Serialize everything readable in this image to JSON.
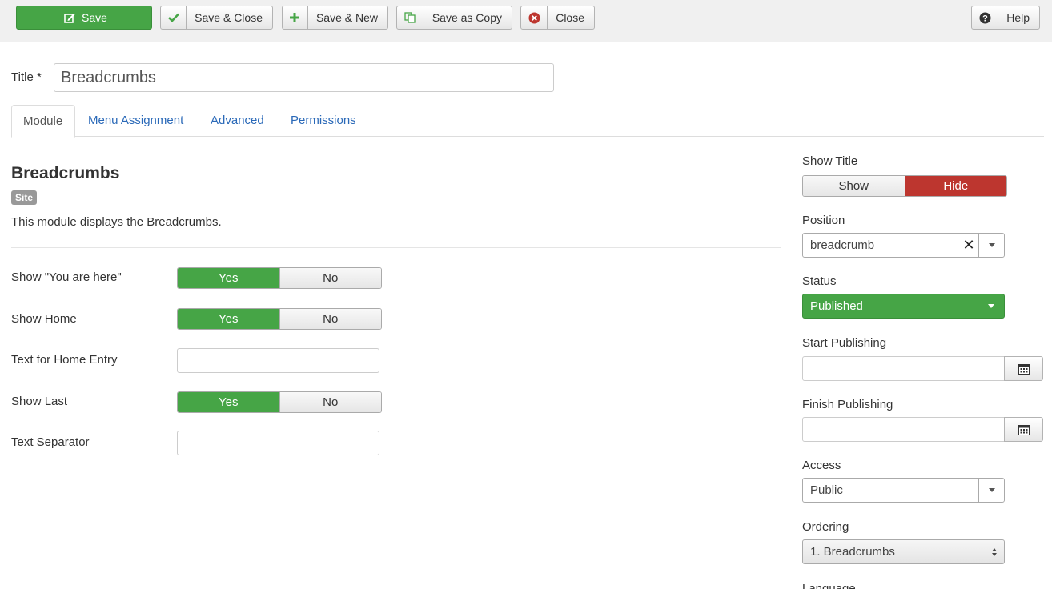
{
  "toolbar": {
    "save_label": "Save",
    "save_close_label": "Save & Close",
    "save_new_label": "Save & New",
    "save_copy_label": "Save as Copy",
    "close_label": "Close",
    "help_label": "Help"
  },
  "title_field": {
    "label": "Title *",
    "value": "Breadcrumbs"
  },
  "tabs": [
    {
      "label": "Module",
      "active": true
    },
    {
      "label": "Menu Assignment"
    },
    {
      "label": "Advanced"
    },
    {
      "label": "Permissions"
    }
  ],
  "module": {
    "heading": "Breadcrumbs",
    "badge": "Site",
    "description": "This module displays the Breadcrumbs."
  },
  "fields": {
    "show_here": {
      "label": "Show \"You are here\"",
      "yes": "Yes",
      "no": "No"
    },
    "show_home": {
      "label": "Show Home",
      "yes": "Yes",
      "no": "No"
    },
    "home_text": {
      "label": "Text for Home Entry",
      "value": ""
    },
    "show_last": {
      "label": "Show Last",
      "yes": "Yes",
      "no": "No"
    },
    "separator": {
      "label": "Text Separator",
      "value": ""
    }
  },
  "sidebar": {
    "show_title": {
      "label": "Show Title",
      "show": "Show",
      "hide": "Hide"
    },
    "position": {
      "label": "Position",
      "value": "breadcrumb"
    },
    "status": {
      "label": "Status",
      "value": "Published"
    },
    "start_publishing": {
      "label": "Start Publishing",
      "value": ""
    },
    "finish_publishing": {
      "label": "Finish Publishing",
      "value": ""
    },
    "access": {
      "label": "Access",
      "value": "Public"
    },
    "ordering": {
      "label": "Ordering",
      "value": "1. Breadcrumbs"
    },
    "language": {
      "label": "Language"
    }
  },
  "colors": {
    "success": "#46a546",
    "danger": "#bd362f",
    "link": "#2a69b8"
  },
  "icons": [
    "edit-icon",
    "check-icon",
    "plus-icon",
    "copy-icon",
    "close-circle-icon",
    "question-icon",
    "calendar-icon",
    "clear-icon",
    "chevron-down-icon"
  ]
}
